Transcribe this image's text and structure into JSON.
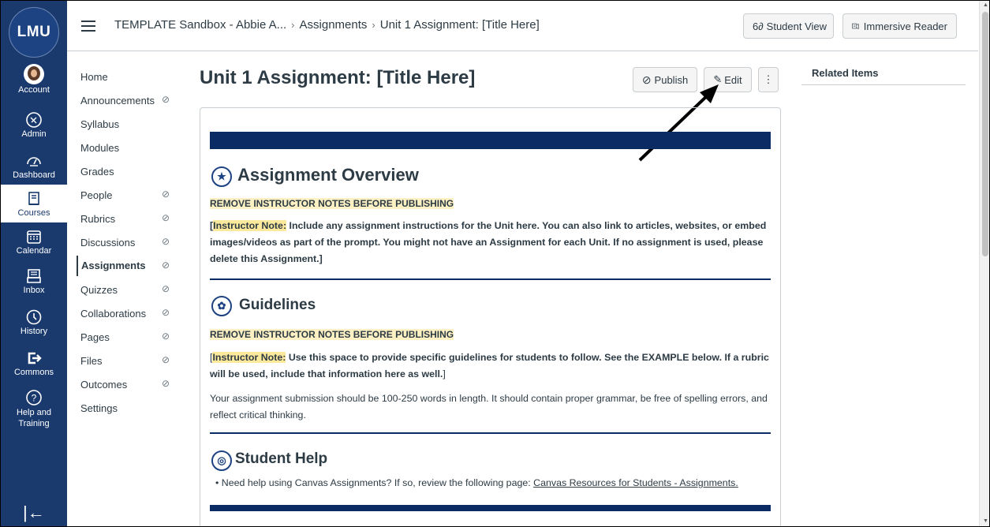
{
  "global_nav": {
    "logo_text": "LMU",
    "items": [
      {
        "label": "Account",
        "icon": "avatar"
      },
      {
        "label": "Admin",
        "icon": "shield-icon"
      },
      {
        "label": "Dashboard",
        "icon": "dashboard-icon"
      },
      {
        "label": "Courses",
        "icon": "book-icon"
      },
      {
        "label": "Calendar",
        "icon": "calendar-icon"
      },
      {
        "label": "Inbox",
        "icon": "inbox-icon"
      },
      {
        "label": "History",
        "icon": "clock-icon"
      },
      {
        "label": "Commons",
        "icon": "commons-icon"
      },
      {
        "label": "Help and Training",
        "icon": "help-icon"
      }
    ],
    "collapse_glyph": "|←"
  },
  "topbar": {
    "breadcrumbs": [
      "TEMPLATE Sandbox - Abbie A...",
      "Assignments",
      "Unit 1 Assignment: [Title Here]"
    ],
    "student_view": "Student View",
    "immersive_reader": "Immersive Reader"
  },
  "course_nav": {
    "items": [
      {
        "label": "Home",
        "hidden": false
      },
      {
        "label": "Announcements",
        "hidden": true
      },
      {
        "label": "Syllabus",
        "hidden": false
      },
      {
        "label": "Modules",
        "hidden": false
      },
      {
        "label": "Grades",
        "hidden": false
      },
      {
        "label": "People",
        "hidden": true
      },
      {
        "label": "Rubrics",
        "hidden": true
      },
      {
        "label": "Discussions",
        "hidden": true
      },
      {
        "label": "Assignments",
        "hidden": true,
        "active": true
      },
      {
        "label": "Quizzes",
        "hidden": true
      },
      {
        "label": "Collaborations",
        "hidden": true
      },
      {
        "label": "Pages",
        "hidden": true
      },
      {
        "label": "Files",
        "hidden": true
      },
      {
        "label": "Outcomes",
        "hidden": true
      },
      {
        "label": "Settings",
        "hidden": false
      }
    ]
  },
  "page": {
    "title": "Unit 1 Assignment: [Title Here]",
    "publish": "Publish",
    "edit": "Edit",
    "more": "⋮"
  },
  "content": {
    "overview_heading": "Assignment Overview",
    "remove_note_1": "REMOVE INSTRUCTOR NOTES BEFORE PUBLISHING",
    "note_label_1": "Instructor Note:",
    "note_text_1": " Include any assignment instructions for the Unit here. You can also link to articles, websites, or embed images/videos as part of the prompt.  You might not have an Assignment for each Unit. If no assignment is used, please delete this Assignment.",
    "guidelines_heading": "Guidelines",
    "remove_note_2": "REMOVE INSTRUCTOR NOTES BEFORE PUBLISHING",
    "note_label_2": "Instructor Note:",
    "note_text_2": " Use this space to provide specific guidelines for students to follow. See the EXAMPLE below. If a rubric will be used, include that information here as well.",
    "example_text": "Your assignment submission should be 100-250 words in length. It should contain proper grammar, be free of spelling errors, and reflect critical thinking.",
    "help_heading": "Student Help",
    "help_text": "Need help using Canvas Assignments? If so, review the following page: ",
    "help_link": "Canvas Resources for Students - Assignments."
  },
  "sidebar": {
    "related_items": "Related Items"
  },
  "colors": {
    "nav_bg": "#1a3a6e",
    "banner": "#0b2b65",
    "highlight": "#fde99b"
  }
}
